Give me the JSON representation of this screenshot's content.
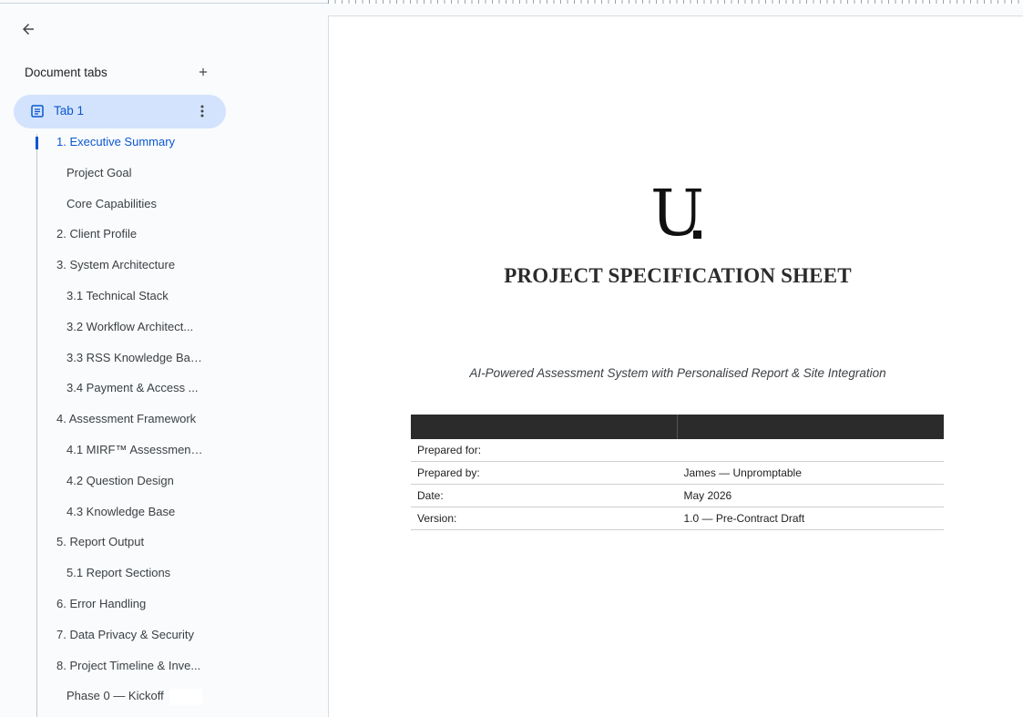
{
  "sidebar": {
    "header_title": "Document tabs",
    "tab": {
      "label": "Tab 1"
    },
    "outline": [
      {
        "label": "1. Executive Summary",
        "level": 1,
        "active": true
      },
      {
        "label": "Project Goal",
        "level": 2
      },
      {
        "label": "Core Capabilities",
        "level": 2
      },
      {
        "label": "2. Client Profile",
        "level": 1
      },
      {
        "label": "3. System Architecture",
        "level": 1
      },
      {
        "label": "3.1 Technical Stack",
        "level": 2
      },
      {
        "label": "3.2 Workflow Architect...",
        "level": 2
      },
      {
        "label": "3.3 RSS Knowledge Bas...",
        "level": 2
      },
      {
        "label": "3.4 Payment & Access ...",
        "level": 2
      },
      {
        "label": "4. Assessment Framework",
        "level": 1
      },
      {
        "label": "4.1 MIRF™ Assessment ...",
        "level": 2
      },
      {
        "label": "4.2 Question Design",
        "level": 2
      },
      {
        "label": "4.3 Knowledge Base",
        "level": 2
      },
      {
        "label": "5. Report Output",
        "level": 1
      },
      {
        "label": "5.1 Report Sections",
        "level": 2
      },
      {
        "label": "6. Error Handling",
        "level": 1
      },
      {
        "label": "7. Data Privacy & Security",
        "level": 1
      },
      {
        "label": "8. Project Timeline & Inve...",
        "level": 1
      },
      {
        "label": "Phase 0 — Kickoff",
        "level": 2
      }
    ]
  },
  "document": {
    "logo_letter": "U",
    "title": "PROJECT SPECIFICATION SHEET",
    "subtitle": "AI-Powered Assessment System with Personalised Report & Site Integration",
    "table": {
      "rows": [
        {
          "label": "Prepared for:",
          "value": ""
        },
        {
          "label": "Prepared by:",
          "value": "James — Unpromptable"
        },
        {
          "label": "Date:",
          "value": "May 2026"
        },
        {
          "label": "Version:",
          "value": "1.0 — Pre-Contract Draft"
        }
      ]
    }
  },
  "colors": {
    "accent": "#0b57d0",
    "tab_selected_bg": "#d3e3fd",
    "table_header_bg": "#2b2b2b"
  },
  "icons": {
    "back": "arrow-left-icon",
    "add": "plus-icon",
    "tab": "document-icon",
    "more": "more-vertical-icon"
  }
}
